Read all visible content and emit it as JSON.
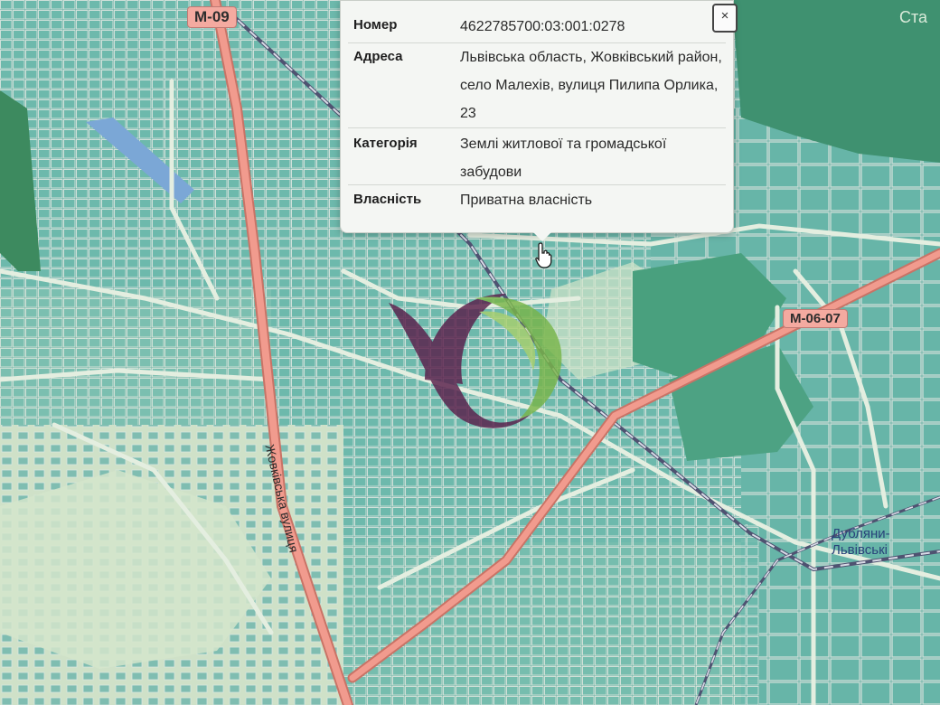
{
  "roads": {
    "m09": "M-09",
    "m0607": "M-06-07"
  },
  "places": {
    "dublyany_line1": "Дубляни-",
    "dublyany_line2": "Львівські",
    "partial_top_right": "Ста"
  },
  "streets": {
    "zhovkivska": "Жовківська вулиця"
  },
  "popup": {
    "close_label": "×",
    "rows": [
      {
        "label": "Номер",
        "value": "4622785700:03:001:0278"
      },
      {
        "label": "Адреса",
        "value": "Львівська область, Жовківський район, село Малехів, вулиця Пилипа Орлика, 23"
      },
      {
        "label": "Категорія",
        "value": "Землі житлової та громадської забудови"
      },
      {
        "label": "Власність",
        "value": "Приватна власність"
      }
    ]
  },
  "colors": {
    "land_light": "#c9dcc2",
    "parcel_fill": "#64b2a6",
    "forest": "#3f9170",
    "main_road": "#ee8d80",
    "railway": "#6c6f86",
    "water": "#7ba7d6",
    "logo_purple": "#5a1f4b",
    "logo_green": "#79b54a"
  },
  "icons": {
    "cursor": "hand-pointer-icon",
    "watermark": "watermark-logo"
  }
}
